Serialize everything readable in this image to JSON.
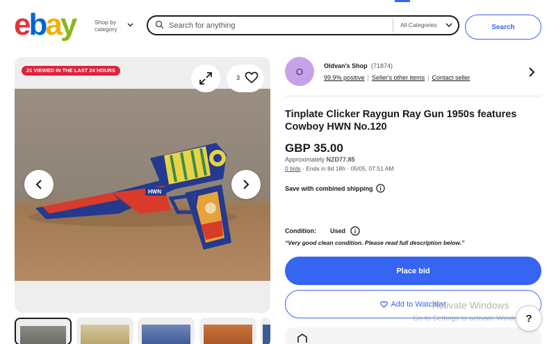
{
  "header": {
    "logo_letters": [
      "e",
      "b",
      "a",
      "y"
    ],
    "logo_colors": [
      "#e53238",
      "#0064d2",
      "#f5af02",
      "#86b817"
    ],
    "shop_by_line1": "Shop by",
    "shop_by_line2": "category",
    "search_placeholder": "Search for anything",
    "category_selected": "All Categories",
    "search_button": "Search"
  },
  "gallery": {
    "viewed_badge": "21 VIEWED IN THE LAST 24 HOURS",
    "watch_count": "3",
    "thumbnail_count": 5
  },
  "seller": {
    "avatar_letter": "O",
    "name": "Oldvan's Shop",
    "feedback_count": "(71874)",
    "positive": "99.9% positive",
    "other_items": "Seller's other items",
    "contact": "Contact seller"
  },
  "item": {
    "title": "Tinplate Clicker Raygun Ray Gun 1950s features Cowboy HWN No.120",
    "price": "GBP 35.00",
    "approx_label": "Approximately",
    "approx_value": "NZD77.85",
    "bids": "0 bids",
    "ends": "Ends in 8d 18h",
    "end_date": "05/05, 07:51 AM",
    "shipping": "Save with combined shipping",
    "condition_label": "Condition:",
    "condition_value": "Used",
    "condition_desc": "“Very good clean condition. Please read full description below.”",
    "place_bid": "Place bid",
    "add_watchlist": "Add to Watchlist",
    "gun_plate_text": "HWN"
  },
  "windows_overlay": {
    "title": "Activate Windows",
    "subtitle": "Go to Settings to activate Windows."
  },
  "help_label": "?",
  "colors": {
    "accent": "#3665f3",
    "badge_red": "#e0213b",
    "avatar": "#c6a3e8"
  }
}
